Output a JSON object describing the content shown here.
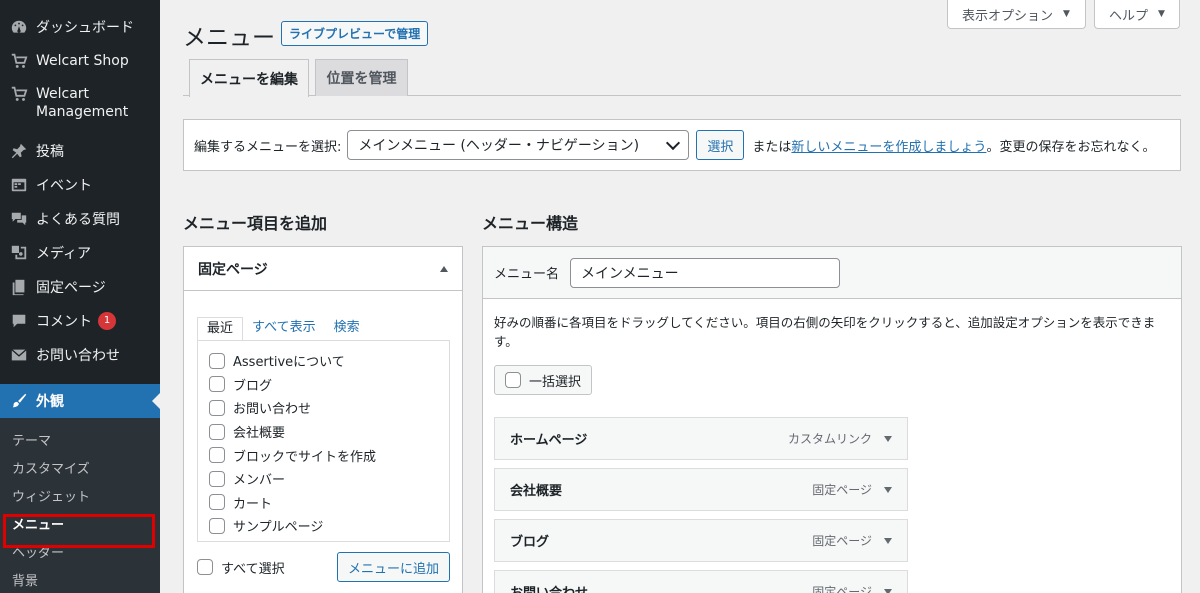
{
  "sidebar": {
    "items": [
      {
        "label": "ダッシュボード",
        "icon": "dashboard-icon"
      },
      {
        "label": "Welcart Shop",
        "icon": "cart-icon"
      },
      {
        "label": "Welcart Management",
        "icon": "cart-icon"
      },
      {
        "label": "投稿",
        "icon": "pin-icon"
      },
      {
        "label": "イベント",
        "icon": "calendar-icon"
      },
      {
        "label": "よくある質問",
        "icon": "chat-icon"
      },
      {
        "label": "メディア",
        "icon": "media-icon"
      },
      {
        "label": "固定ページ",
        "icon": "page-icon"
      },
      {
        "label": "コメント",
        "icon": "comment-icon",
        "badge": "1"
      },
      {
        "label": "お問い合わせ",
        "icon": "mail-icon"
      },
      {
        "label": "外観",
        "icon": "brush-icon"
      }
    ],
    "submenu": [
      "テーマ",
      "カスタマイズ",
      "ウィジェット",
      "メニュー",
      "ヘッダー",
      "背景"
    ]
  },
  "top_buttons": {
    "screen_options": "表示オプション",
    "help": "ヘルプ"
  },
  "header": {
    "title": "メニュー",
    "live_preview": "ライブプレビューで管理"
  },
  "tabs": [
    "メニューを編集",
    "位置を管理"
  ],
  "select_bar": {
    "label": "編集するメニューを選択:",
    "selected": "メインメニュー (ヘッダー・ナビゲーション)",
    "button": "選択",
    "text_before": "または",
    "link": "新しいメニューを作成しましょう",
    "text_after": "。変更の保存をお忘れなく。"
  },
  "left": {
    "heading": "メニュー項目を追加",
    "box_title": "固定ページ",
    "tabs": [
      "最近",
      "すべて表示",
      "検索"
    ],
    "pages": [
      "Assertiveについて",
      "ブログ",
      "お問い合わせ",
      "会社概要",
      "ブロックでサイトを作成",
      "メンバー",
      "カート",
      "サンプルページ"
    ],
    "select_all": "すべて選択",
    "add_button": "メニューに追加"
  },
  "right": {
    "heading": "メニュー構造",
    "name_label": "メニュー名",
    "name_value": "メインメニュー",
    "description": "好みの順番に各項目をドラッグしてください。項目の右側の矢印をクリックすると、追加設定オプションを表示できます。",
    "bulk_select": "一括選択",
    "items": [
      {
        "title": "ホームページ",
        "type": "カスタムリンク"
      },
      {
        "title": "会社概要",
        "type": "固定ページ"
      },
      {
        "title": "ブログ",
        "type": "固定ページ"
      },
      {
        "title": "お問い合わせ",
        "type": "固定ページ"
      }
    ]
  }
}
